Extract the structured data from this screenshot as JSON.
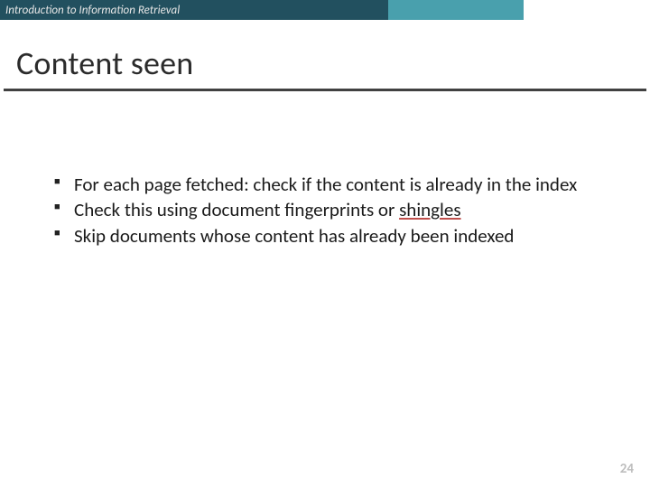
{
  "header": {
    "course_title": "Introduction to Information Retrieval"
  },
  "slide": {
    "title": "Content seen",
    "bullets": [
      {
        "pre": "For each page fetched: check if the content is already in the index",
        "link": "",
        "post": ""
      },
      {
        "pre": "Check this using document fingerprints or ",
        "link": "shingles",
        "post": ""
      },
      {
        "pre": "Skip documents whose content has already been indexed",
        "link": "",
        "post": ""
      }
    ],
    "page_number": "24"
  }
}
